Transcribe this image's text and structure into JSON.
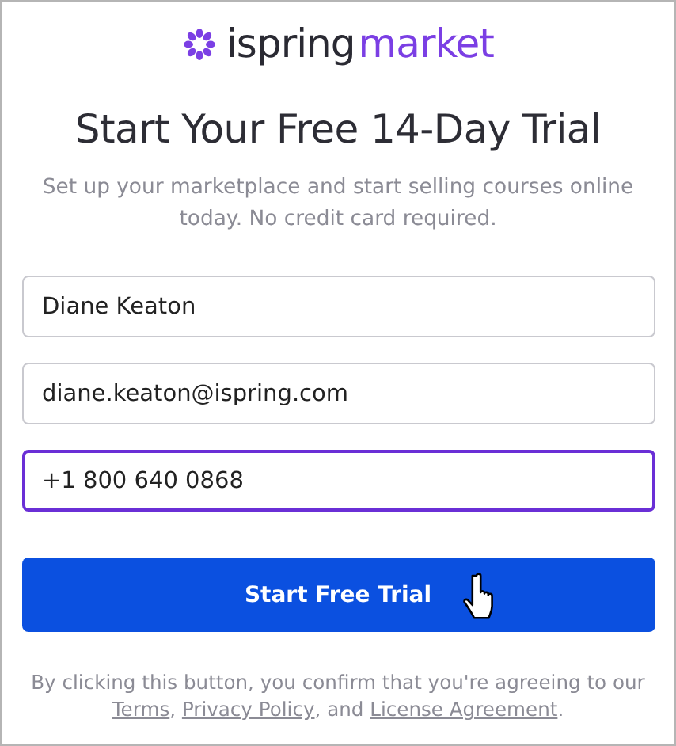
{
  "logo": {
    "brand": "ispring",
    "product": "market"
  },
  "title": "Start Your Free 14-Day Trial",
  "subtitle": "Set up your marketplace and start selling courses online today. No credit card required.",
  "fields": [
    {
      "value": "Diane Keaton",
      "focused": false
    },
    {
      "value": "diane.keaton@ispring.com",
      "focused": false
    },
    {
      "value": "+1 800 640 0868",
      "focused": true
    }
  ],
  "button": {
    "label": "Start Free Trial"
  },
  "legal": [
    {
      "kind": "text",
      "text": "By clicking this button, you confirm that you're agreeing to our "
    },
    {
      "kind": "link",
      "text": "Terms"
    },
    {
      "kind": "text",
      "text": ", "
    },
    {
      "kind": "link",
      "text": "Privacy Policy"
    },
    {
      "kind": "text",
      "text": ", and "
    },
    {
      "kind": "link",
      "text": "License Agreement"
    },
    {
      "kind": "text",
      "text": "."
    }
  ]
}
